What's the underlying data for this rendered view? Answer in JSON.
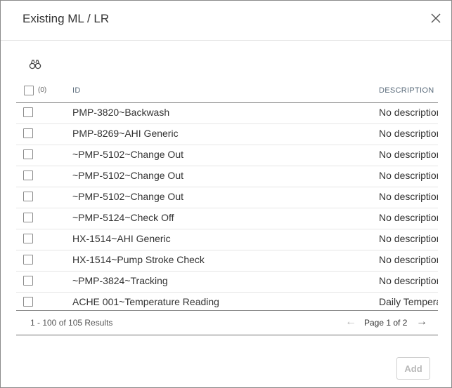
{
  "dialog": {
    "title": "Existing ML / LR",
    "close_icon": "close-icon",
    "search_icon": "binoculars-icon"
  },
  "table": {
    "selected_count": "(0)",
    "columns": {
      "id": "ID",
      "description": "DESCRIPTION"
    },
    "rows": [
      {
        "id": "PMP-3820~Backwash",
        "description": "No description"
      },
      {
        "id": "PMP-8269~AHI Generic",
        "description": "No description"
      },
      {
        "id": "~PMP-5102~Change Out",
        "description": "No description"
      },
      {
        "id": "~PMP-5102~Change Out",
        "description": "No description"
      },
      {
        "id": "~PMP-5102~Change Out",
        "description": "No description"
      },
      {
        "id": "~PMP-5124~Check Off",
        "description": "No description"
      },
      {
        "id": "HX-1514~AHI Generic",
        "description": "No description"
      },
      {
        "id": "HX-1514~Pump Stroke Check",
        "description": "No description"
      },
      {
        "id": "~PMP-3824~Tracking",
        "description": "No description"
      },
      {
        "id": "ACHE 001~Temperature Reading",
        "description": "Daily Temperature"
      }
    ]
  },
  "pagination": {
    "results_text": "1 - 100 of 105 Results",
    "page_text": "Page 1 of 2",
    "prev_icon": "arrow-left-icon",
    "next_icon": "arrow-right-icon"
  },
  "footer": {
    "add_label": "Add"
  },
  "colors": {
    "border": "#8a8a8a",
    "header_text": "#5a6b7b",
    "disabled": "#b8b8b8"
  }
}
